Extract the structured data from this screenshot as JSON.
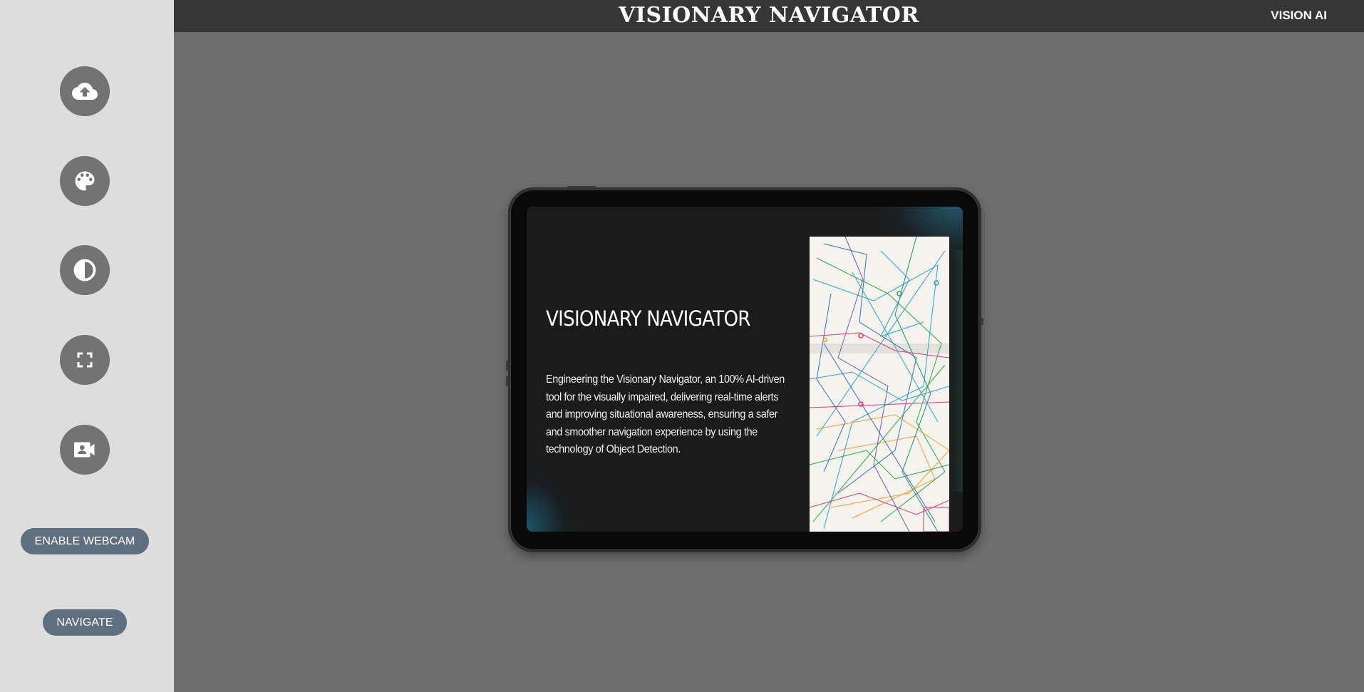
{
  "header": {
    "title": "VISIONARY NAVIGATOR",
    "brand": "VISION AI"
  },
  "sidebar": {
    "tools": [
      {
        "name": "upload",
        "icon": "cloud-upload-icon"
      },
      {
        "name": "theme",
        "icon": "palette-icon"
      },
      {
        "name": "contrast",
        "icon": "contrast-icon"
      },
      {
        "name": "fullscreen",
        "icon": "fullscreen-icon"
      },
      {
        "name": "camera",
        "icon": "video-camera-icon"
      }
    ],
    "enable_webcam_label": "ENABLE WEBCAM",
    "navigate_label": "NAVIGATE"
  },
  "slide": {
    "title": "VISIONARY NAVIGATOR",
    "description": "Engineering the Visionary Navigator, an 100% AI-driven tool for the visually impaired, delivering real-time alerts and improving situational awareness, ensuring a safer and smoother navigation experience by using the technology of Object Detection."
  },
  "colors": {
    "sidebar_bg": "#dddddd",
    "header_bg": "#363636",
    "main_bg": "#6e6e6e",
    "tool_button": "#737373",
    "pill_button": "#5f6f80"
  }
}
